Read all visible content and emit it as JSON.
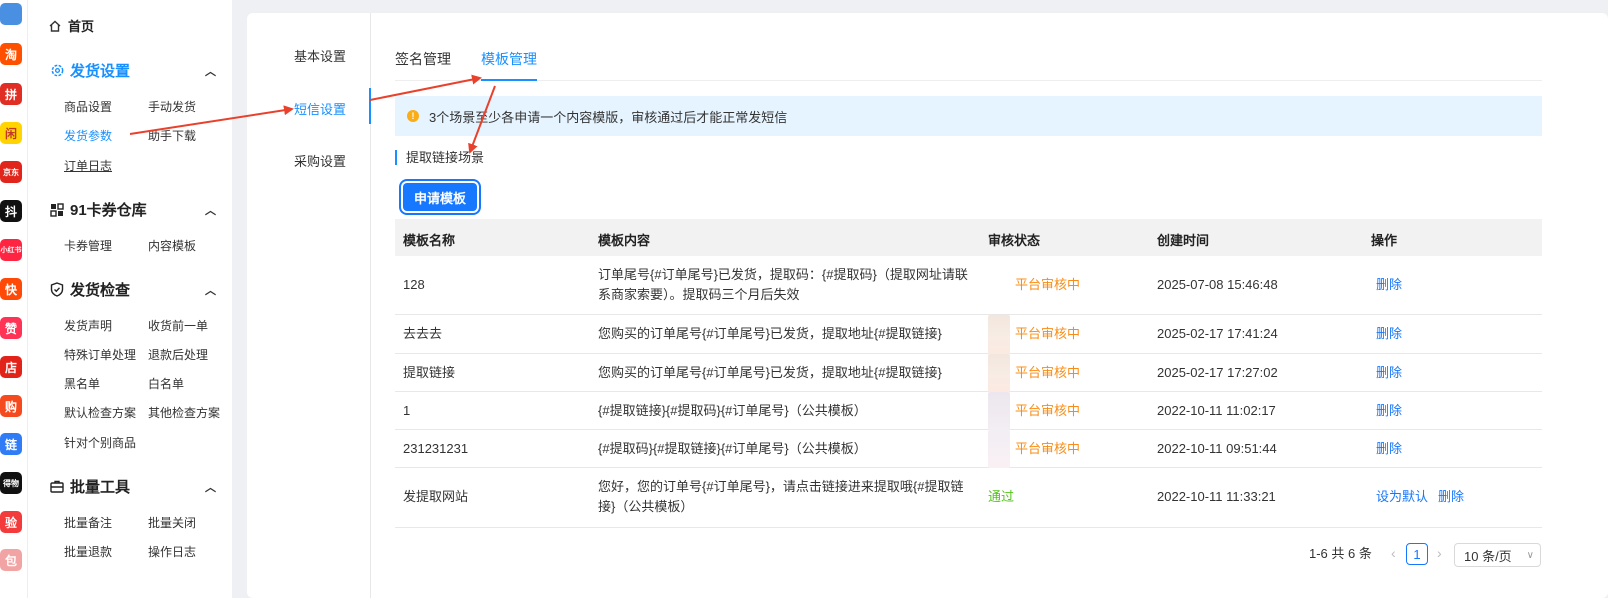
{
  "apps": [
    {
      "name": "grid-app-icon",
      "label": "",
      "color": "#4a90e2"
    },
    {
      "name": "taobao-icon",
      "label": "淘",
      "color": "#ff5000"
    },
    {
      "name": "pinduoduo-icon",
      "label": "拼",
      "color": "#e02e24"
    },
    {
      "name": "xianyu-icon",
      "label": "闲",
      "color": "#ffd400"
    },
    {
      "name": "jd-icon",
      "label": "京东",
      "color": "#e1251b"
    },
    {
      "name": "douyin-icon",
      "label": "抖",
      "color": "#111111"
    },
    {
      "name": "xiaohongshu-icon",
      "label": "小红书",
      "color": "#ff2442"
    },
    {
      "name": "kuaishou-icon",
      "label": "快",
      "color": "#ff4906"
    },
    {
      "name": "thumb-icon",
      "label": "赞",
      "color": "#fe3355"
    },
    {
      "name": "shop-icon",
      "label": "店",
      "color": "#e2231a"
    },
    {
      "name": "bag-icon",
      "label": "购",
      "color": "#f54a1e"
    },
    {
      "name": "link-icon",
      "label": "链",
      "color": "#2f7cf6"
    },
    {
      "name": "dewu-icon",
      "label": "得物",
      "color": "#111111"
    },
    {
      "name": "check-icon",
      "label": "验",
      "color": "#f33b3b"
    },
    {
      "name": "bag2-icon",
      "label": "包",
      "color": "#f2a3a3"
    }
  ],
  "sidebar": {
    "home": "首页",
    "sections": [
      {
        "title": "发货设置",
        "active": true,
        "items": [
          "商品设置",
          "手动发货",
          "发货参数",
          "助手下载",
          "订单日志"
        ]
      },
      {
        "title": "91卡券仓库",
        "items": [
          "卡券管理",
          "内容模板"
        ]
      },
      {
        "title": "发货检查",
        "items": [
          "发货声明",
          "收货前一单",
          "特殊订单处理",
          "退款后处理",
          "黑名单",
          "白名单",
          "默认检查方案",
          "其他检查方案",
          "针对个别商品"
        ]
      },
      {
        "title": "批量工具",
        "items": [
          "批量备注",
          "批量关闭",
          "批量退款",
          "操作日志"
        ]
      }
    ]
  },
  "left_menu": [
    "基本设置",
    "短信设置",
    "采购设置"
  ],
  "tabs": [
    "签名管理",
    "模板管理"
  ],
  "alert": "3个场景至少各申请一个内容模版，审核通过后才能正常发短信",
  "scene": "提取链接场景",
  "apply_button": "申请模板",
  "table": {
    "headers": [
      "模板名称",
      "模板内容",
      "审核状态",
      "创建时间",
      "操作"
    ],
    "rows": [
      {
        "name": "128",
        "content": "订单尾号{#订单尾号}已发货，提取码：{#提取码}（提取网址请联系商家索要）。提取码三个月后失效",
        "status": "平台审核中",
        "time": "2025-07-08 15:46:48",
        "actions": [
          "删除"
        ]
      },
      {
        "name": "去去去",
        "content": "您购买的订单尾号{#订单尾号}已发货，提取地址{#提取链接}",
        "status": "平台审核中",
        "time": "2025-02-17 17:41:24",
        "actions": [
          "删除"
        ]
      },
      {
        "name": "提取链接",
        "content": "您购买的订单尾号{#订单尾号}已发货，提取地址{#提取链接}",
        "status": "平台审核中",
        "time": "2025-02-17 17:27:02",
        "actions": [
          "删除"
        ]
      },
      {
        "name": "1",
        "content": "{#提取链接}{#提取码}{#订单尾号}（公共模板）",
        "status": "平台审核中",
        "time": "2022-10-11 11:02:17",
        "actions": [
          "删除"
        ]
      },
      {
        "name": "231231231",
        "content": "{#提取码}{#提取链接}{#订单尾号}（公共模板）",
        "status": "平台审核中",
        "time": "2022-10-11 09:51:44",
        "actions": [
          "删除"
        ]
      },
      {
        "name": "发提取网站",
        "content": "您好，您的订单号{#订单尾号}，请点击链接进来提取哦{#提取链接}（公共模板）",
        "status": "通过",
        "time": "2022-10-11 11:33:21",
        "actions": [
          "设为默认",
          "删除"
        ]
      }
    ]
  },
  "pagination": {
    "summary": "1-6 共 6 条",
    "current": "1",
    "page_size": "10 条/页"
  },
  "colors": {
    "accent": "#1677ff",
    "pending": "#fa8c16",
    "pass": "#52c41a",
    "arrow": "#e8412c"
  }
}
